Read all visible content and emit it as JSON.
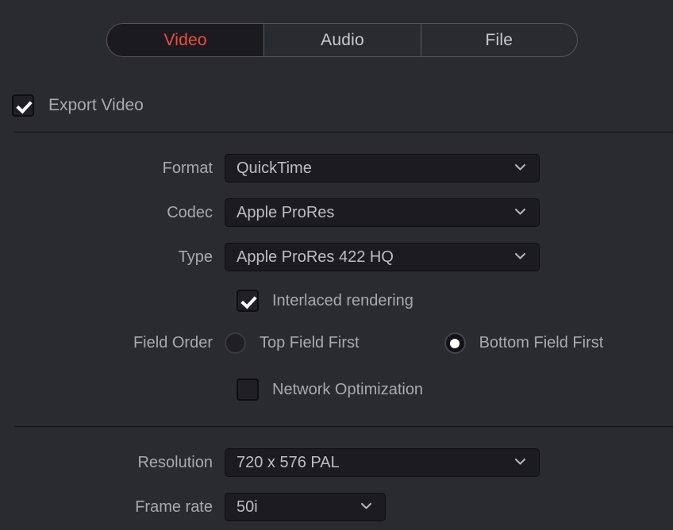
{
  "tabs": [
    {
      "label": "Video",
      "active": true
    },
    {
      "label": "Audio",
      "active": false
    },
    {
      "label": "File",
      "active": false
    }
  ],
  "export_video": {
    "label": "Export Video",
    "checked": true
  },
  "video_settings": {
    "format": {
      "label": "Format",
      "value": "QuickTime"
    },
    "codec": {
      "label": "Codec",
      "value": "Apple ProRes"
    },
    "type": {
      "label": "Type",
      "value": "Apple ProRes 422 HQ"
    },
    "interlaced_rendering": {
      "label": "Interlaced rendering",
      "checked": true
    },
    "field_order": {
      "label": "Field Order",
      "options": [
        {
          "label": "Top Field First",
          "selected": false
        },
        {
          "label": "Bottom Field First",
          "selected": true
        }
      ]
    },
    "network_optimization": {
      "label": "Network Optimization",
      "checked": false
    }
  },
  "output_settings": {
    "resolution": {
      "label": "Resolution",
      "value": "720 x 576 PAL"
    },
    "frame_rate": {
      "label": "Frame rate",
      "value": "50i"
    }
  },
  "icons": {
    "chevron_down": "chevron-down-icon",
    "checkmark": "checkmark-icon",
    "radio_dot": "radio-dot-icon"
  },
  "colors": {
    "background": "#2a2a31",
    "field_background": "#1c1c20",
    "accent_active_tab": "#ef4d3c",
    "label_text": "#a9a9ae",
    "value_text": "#bdbdc2",
    "divider": "#141417"
  }
}
